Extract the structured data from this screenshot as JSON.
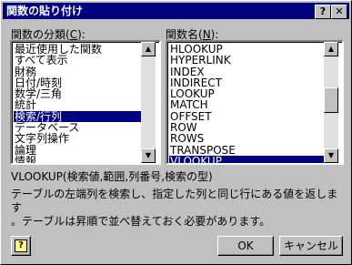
{
  "window": {
    "title": "関数の貼り付け",
    "help_btn": "?",
    "close_btn": "✕"
  },
  "category": {
    "label_prefix": "関数の分類(",
    "label_key": "C",
    "label_suffix": "):",
    "items": [
      "最近使用した関数",
      "すべて表示",
      "財務",
      "日付/時刻",
      "数学/三角",
      "統計",
      "検索/行列",
      "データベース",
      "文字列操作",
      "論理",
      "情報"
    ],
    "selected": "検索/行列"
  },
  "functions": {
    "label_prefix": "関数名(",
    "label_key": "N",
    "label_suffix": "):",
    "items": [
      "HLOOKUP",
      "HYPERLINK",
      "INDEX",
      "INDIRECT",
      "LOOKUP",
      "MATCH",
      "OFFSET",
      "ROW",
      "ROWS",
      "TRANSPOSE",
      "VLOOKUP"
    ],
    "selected": "VLOOKUP"
  },
  "syntax": "VLOOKUP(検索値,範囲,列番号,検索の型)",
  "description_line1": "テーブルの左端列を検索し、指定した列と同じ行にある値を返します",
  "description_line2": "。テーブルは昇順で並べ替えておく必要があります。",
  "buttons": {
    "ok": "OK",
    "cancel": "キャンセル",
    "help_icon": "?"
  }
}
